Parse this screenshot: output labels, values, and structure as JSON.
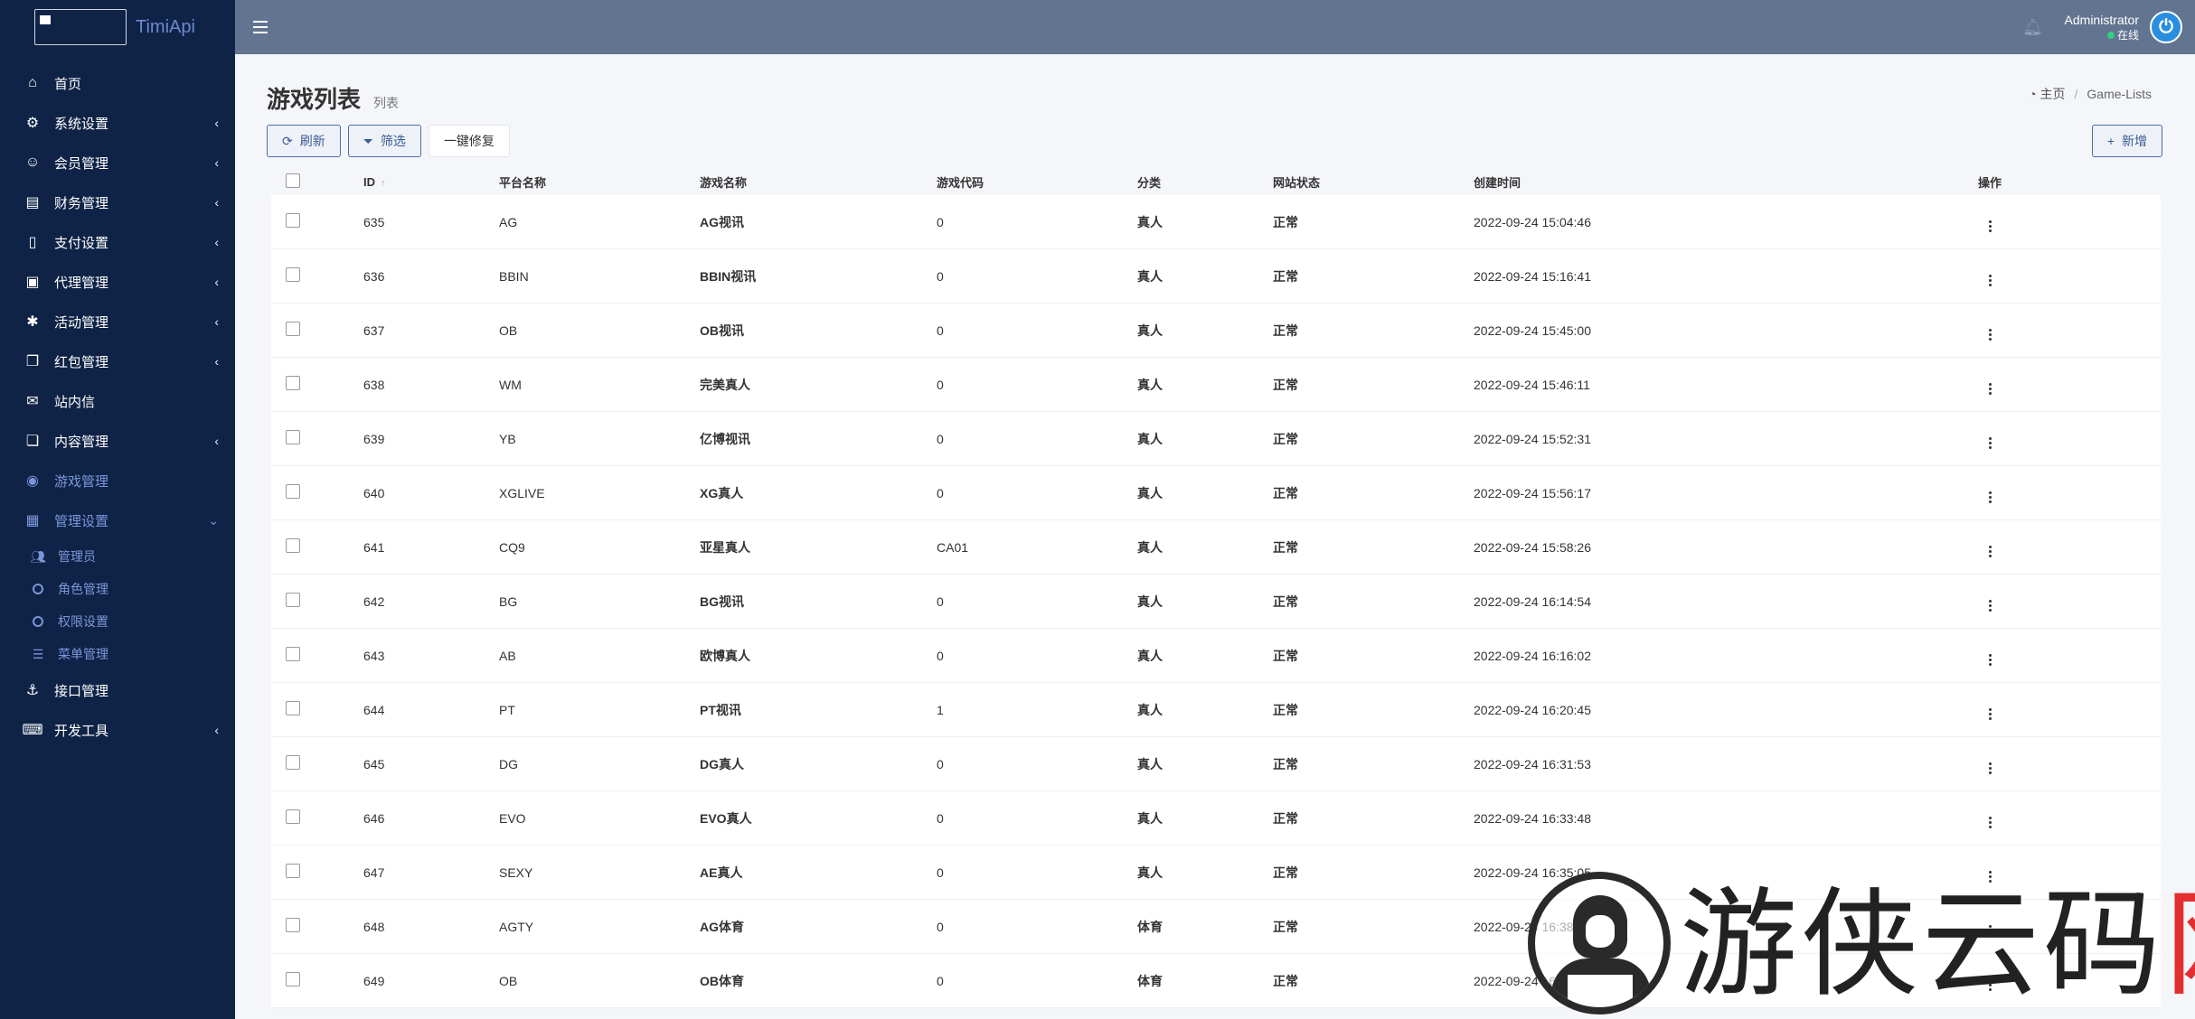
{
  "brand": {
    "name": "TimiApi"
  },
  "sidebar": {
    "items": [
      {
        "label": "首页",
        "icon": "home-icon",
        "glyph": "⌂",
        "chevron": false
      },
      {
        "label": "系统设置",
        "icon": "cogs-icon",
        "glyph": "⚙",
        "chevron": true
      },
      {
        "label": "会员管理",
        "icon": "user-icon",
        "glyph": "☺",
        "chevron": true
      },
      {
        "label": "财务管理",
        "icon": "database-icon",
        "glyph": "▤",
        "chevron": true
      },
      {
        "label": "支付设置",
        "icon": "bookmark-icon",
        "glyph": "▯",
        "chevron": true
      },
      {
        "label": "代理管理",
        "icon": "address-book-icon",
        "glyph": "▣",
        "chevron": true
      },
      {
        "label": "活动管理",
        "icon": "snowflake-icon",
        "glyph": "✱",
        "chevron": true
      },
      {
        "label": "红包管理",
        "icon": "clone-icon",
        "glyph": "❐",
        "chevron": true
      },
      {
        "label": "站内信",
        "icon": "envelope-icon",
        "glyph": "✉",
        "chevron": false
      },
      {
        "label": "内容管理",
        "icon": "copy-icon",
        "glyph": "❏",
        "chevron": true
      },
      {
        "label": "游戏管理",
        "icon": "gamepad-icon",
        "glyph": "◉",
        "chevron": false,
        "active": true
      },
      {
        "label": "管理设置",
        "icon": "id-card-icon",
        "glyph": "▦",
        "chevron": true,
        "active": true,
        "open": true
      }
    ],
    "subitems": [
      {
        "label": "管理员",
        "icon": "users-icon"
      },
      {
        "label": "角色管理",
        "icon": "circle-icon"
      },
      {
        "label": "权限设置",
        "icon": "circle-icon"
      },
      {
        "label": "菜单管理",
        "icon": "bars-icon"
      }
    ],
    "items_after": [
      {
        "label": "接口管理",
        "icon": "anchor-icon",
        "glyph": "⚓",
        "chevron": false
      },
      {
        "label": "开发工具",
        "icon": "keyboard-icon",
        "glyph": "⌨",
        "chevron": true
      }
    ]
  },
  "navbar": {
    "user_name": "Administrator",
    "user_status": "在线"
  },
  "page": {
    "title": "游戏列表",
    "subtitle": "列表",
    "breadcrumb": {
      "home": "主页",
      "current": "Game-Lists"
    }
  },
  "toolbar": {
    "refresh": "刷新",
    "filter": "筛选",
    "repair": "一键修复",
    "add": "新增"
  },
  "table": {
    "columns": [
      "ID",
      "平台名称",
      "游戏名称",
      "游戏代码",
      "分类",
      "网站状态",
      "创建时间",
      "操作"
    ],
    "rows": [
      {
        "id": "635",
        "platform": "AG",
        "game": "AG视讯",
        "code": "0",
        "type": "真人",
        "status": "正常",
        "time": "2022-09-24 15:04:46"
      },
      {
        "id": "636",
        "platform": "BBIN",
        "game": "BBIN视讯",
        "code": "0",
        "type": "真人",
        "status": "正常",
        "time": "2022-09-24 15:16:41"
      },
      {
        "id": "637",
        "platform": "OB",
        "game": "OB视讯",
        "code": "0",
        "type": "真人",
        "status": "正常",
        "time": "2022-09-24 15:45:00"
      },
      {
        "id": "638",
        "platform": "WM",
        "game": "完美真人",
        "code": "0",
        "type": "真人",
        "status": "正常",
        "time": "2022-09-24 15:46:11"
      },
      {
        "id": "639",
        "platform": "YB",
        "game": "亿博视讯",
        "code": "0",
        "type": "真人",
        "status": "正常",
        "time": "2022-09-24 15:52:31"
      },
      {
        "id": "640",
        "platform": "XGLIVE",
        "game": "XG真人",
        "code": "0",
        "type": "真人",
        "status": "正常",
        "time": "2022-09-24 15:56:17"
      },
      {
        "id": "641",
        "platform": "CQ9",
        "game": "亚星真人",
        "code": "CA01",
        "type": "真人",
        "status": "正常",
        "time": "2022-09-24 15:58:26"
      },
      {
        "id": "642",
        "platform": "BG",
        "game": "BG视讯",
        "code": "0",
        "type": "真人",
        "status": "正常",
        "time": "2022-09-24 16:14:54"
      },
      {
        "id": "643",
        "platform": "AB",
        "game": "欧博真人",
        "code": "0",
        "type": "真人",
        "status": "正常",
        "time": "2022-09-24 16:16:02"
      },
      {
        "id": "644",
        "platform": "PT",
        "game": "PT视讯",
        "code": "1",
        "type": "真人",
        "status": "正常",
        "time": "2022-09-24 16:20:45"
      },
      {
        "id": "645",
        "platform": "DG",
        "game": "DG真人",
        "code": "0",
        "type": "真人",
        "status": "正常",
        "time": "2022-09-24 16:31:53"
      },
      {
        "id": "646",
        "platform": "EVO",
        "game": "EVO真人",
        "code": "0",
        "type": "真人",
        "status": "正常",
        "time": "2022-09-24 16:33:48"
      },
      {
        "id": "647",
        "platform": "SEXY",
        "game": "AE真人",
        "code": "0",
        "type": "真人",
        "status": "正常",
        "time": "2022-09-24 16:35:05"
      },
      {
        "id": "648",
        "platform": "AGTY",
        "game": "AG体育",
        "code": "0",
        "type": "体育",
        "status": "正常",
        "time": "2022-09-24 16:38:36"
      },
      {
        "id": "649",
        "platform": "OB",
        "game": "OB体育",
        "code": "0",
        "type": "体育",
        "status": "正常",
        "time": "2022-09-24 16:40:31"
      }
    ]
  },
  "watermark": {
    "text": "游侠云码",
    "accent": "网"
  },
  "colors": {
    "sidebar": "#0f2347",
    "navbar": "#627490",
    "accent": "#7b96d8",
    "online": "#30d080",
    "power": "#2a8ee0"
  }
}
